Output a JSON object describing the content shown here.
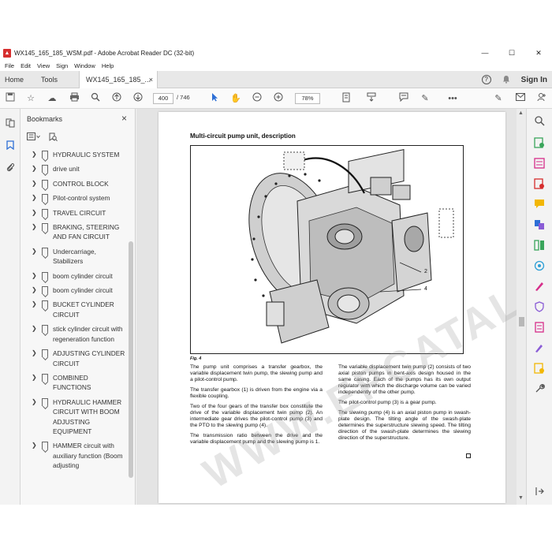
{
  "window": {
    "title": "WX145_165_185_WSM.pdf - Adobe Acrobat Reader DC (32-bit)",
    "minimize": "—",
    "maximize": "☐",
    "close": "✕"
  },
  "menu": [
    "File",
    "Edit",
    "View",
    "Sign",
    "Window",
    "Help"
  ],
  "tabs": {
    "home": "Home",
    "tools": "Tools",
    "document": "WX145_165_185_...",
    "close": "×",
    "help": "?",
    "sign_in": "Sign In"
  },
  "toolbar": {
    "page_current": "400",
    "page_total": "/ 746",
    "zoom": "78%",
    "more": "•••"
  },
  "bookmarks": {
    "header": "Bookmarks",
    "close": "×",
    "items": [
      {
        "label": "HYDRAULIC SYSTEM"
      },
      {
        "label": "drive unit"
      },
      {
        "label": "CONTROL BLOCK"
      },
      {
        "label": "Pilot-control system"
      },
      {
        "label": "TRAVEL CIRCUIT"
      },
      {
        "label": "BRAKING, STEERING AND FAN CIRCUIT"
      },
      {
        "label": "Undercarriage, Stabilizers"
      },
      {
        "label": "boom cylinder circuit"
      },
      {
        "label": "boom cylinder circuit"
      },
      {
        "label": "BUCKET CYLINDER CIRCUIT"
      },
      {
        "label": "stick cylinder circuit with regeneration function"
      },
      {
        "label": "ADJUSTING CYLINDER CIRCUIT"
      },
      {
        "label": "COMBINED FUNCTIONS"
      },
      {
        "label": "HYDRAULIC HAMMER CIRCUIT WITH BOOM ADJUSTING EQUIPMENT"
      },
      {
        "label": "HAMMER circuit with auxiliary function (Boom adjusting"
      }
    ]
  },
  "document": {
    "heading": "Multi-circuit pump unit, description",
    "figure_caption": "Fig. 4",
    "callout_2": "2",
    "callout_4": "4",
    "watermark": "WWW.EPCATALOGS.COM",
    "left_paragraphs": [
      "The pump unit comprises a transfer gearbox, the variable displacement twin pump, the slewing pump and a pilot-control pump.",
      "The transfer gearbox (1) is driven from the engine via a flexible coupling.",
      "Two of the four gears of the transfer box constitute the drive of the variable displacement twin pump (2). An intermediate gear drives the pilot-control pump (3) and the PTO to the slewing pump (4).",
      "The transmission ratio between the drive and the variable displacement pump and the slewing pump is 1."
    ],
    "right_paragraphs": [
      "The variable displacement twin pump (2) consists of two axial piston pumps in bent-axis design housed in the same casing. Each of the pumps has its own output regulator with which the discharge volume can be varied independently of the other pump.",
      "The pilot-control pump (3) is a gear pump.",
      "The slewing pump (4) is an axial piston pump in swash-plate design. The tilting angle of the swash-plate determines the superstructure slewing speed. The tilting direction of the swash-plate determines the slewing direction of the superstructure."
    ]
  },
  "colors": {
    "accent_blue": "#2d6fd6",
    "acrobat_red": "#d62e2e"
  }
}
